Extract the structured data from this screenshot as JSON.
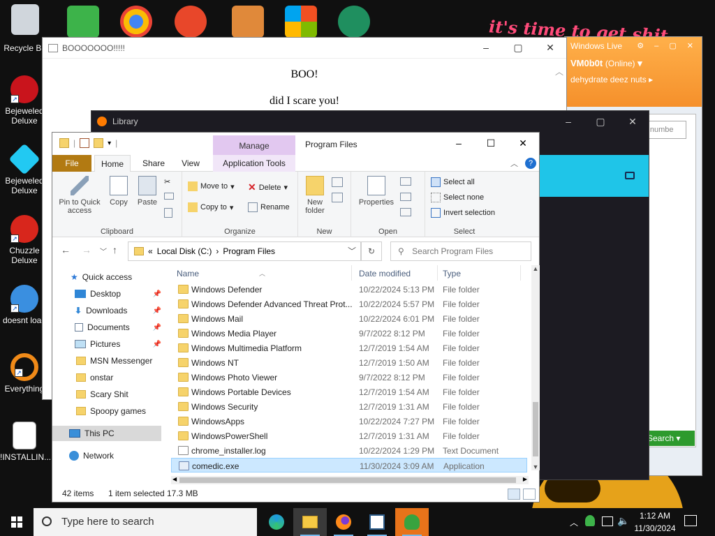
{
  "desktop": {
    "icons": [
      {
        "label": "Recycle Bin"
      },
      {
        "label": "Bejeweled\nDeluxe"
      },
      {
        "label": "Bejeweled\nDeluxe"
      },
      {
        "label": "Chuzzle\nDeluxe"
      },
      {
        "label": "doesnt load"
      },
      {
        "label": "Everything"
      },
      {
        "label": "!INSTALLIN..."
      }
    ],
    "graffiti": "it's time to get shit"
  },
  "boo_window": {
    "title": "BOOOOOOO!!!!!",
    "heading": "BOO!",
    "text": "did I scare you!"
  },
  "messenger": {
    "title": "Windows Live",
    "user": "VM0b0t",
    "status": "(Online)",
    "personal_message": "dehydrate deez nuts",
    "search_placeholder": "or numbe",
    "search_button": "Search"
  },
  "library_window": {
    "title": "Library"
  },
  "explorer": {
    "title": "Program Files",
    "manage_tab": "Manage",
    "tabs": {
      "file": "File",
      "home": "Home",
      "share": "Share",
      "view": "View",
      "app_tools": "Application Tools"
    },
    "ribbon": {
      "pin": "Pin to Quick access",
      "copy": "Copy",
      "paste": "Paste",
      "clipboard": "Clipboard",
      "move_to": "Move to",
      "copy_to": "Copy to",
      "delete": "Delete",
      "rename": "Rename",
      "organize": "Organize",
      "new_folder": "New folder",
      "new": "New",
      "properties": "Properties",
      "open": "Open",
      "select_all": "Select all",
      "select_none": "Select none",
      "invert_selection": "Invert selection",
      "select": "Select"
    },
    "address": {
      "root": "«",
      "disk": "Local Disk (C:)",
      "sep": "›",
      "folder": "Program Files"
    },
    "search_placeholder": "Search Program Files",
    "nav": [
      {
        "label": "Quick access"
      },
      {
        "label": "Desktop",
        "pinned": true
      },
      {
        "label": "Downloads",
        "pinned": true
      },
      {
        "label": "Documents",
        "pinned": true
      },
      {
        "label": "Pictures",
        "pinned": true
      },
      {
        "label": "MSN Messenger"
      },
      {
        "label": "onstar"
      },
      {
        "label": "Scary Shit"
      },
      {
        "label": "Spoopy games"
      },
      {
        "label": "This PC"
      },
      {
        "label": "Network"
      }
    ],
    "columns": {
      "name": "Name",
      "date": "Date modified",
      "type": "Type"
    },
    "files": [
      {
        "name": "Windows Defender",
        "date": "10/22/2024 5:13 PM",
        "type": "File folder",
        "kind": "folder"
      },
      {
        "name": "Windows Defender Advanced Threat Prot...",
        "date": "10/22/2024 5:57 PM",
        "type": "File folder",
        "kind": "folder"
      },
      {
        "name": "Windows Mail",
        "date": "10/22/2024 6:01 PM",
        "type": "File folder",
        "kind": "folder"
      },
      {
        "name": "Windows Media Player",
        "date": "9/7/2022 8:12 PM",
        "type": "File folder",
        "kind": "folder"
      },
      {
        "name": "Windows Multimedia Platform",
        "date": "12/7/2019 1:54 AM",
        "type": "File folder",
        "kind": "folder"
      },
      {
        "name": "Windows NT",
        "date": "12/7/2019 1:50 AM",
        "type": "File folder",
        "kind": "folder"
      },
      {
        "name": "Windows Photo Viewer",
        "date": "9/7/2022 8:12 PM",
        "type": "File folder",
        "kind": "folder"
      },
      {
        "name": "Windows Portable Devices",
        "date": "12/7/2019 1:54 AM",
        "type": "File folder",
        "kind": "folder"
      },
      {
        "name": "Windows Security",
        "date": "12/7/2019 1:31 AM",
        "type": "File folder",
        "kind": "folder"
      },
      {
        "name": "WindowsApps",
        "date": "10/22/2024 7:27 PM",
        "type": "File folder",
        "kind": "folder"
      },
      {
        "name": "WindowsPowerShell",
        "date": "12/7/2019 1:31 AM",
        "type": "File folder",
        "kind": "folder"
      },
      {
        "name": "chrome_installer.log",
        "date": "10/22/2024 1:29 PM",
        "type": "Text Document",
        "kind": "file"
      },
      {
        "name": "comedic.exe",
        "date": "11/30/2024 3:09 AM",
        "type": "Application",
        "kind": "exe",
        "selected": true
      }
    ],
    "status": {
      "items": "42 items",
      "selected": "1 item selected",
      "size": "17.3 MB"
    }
  },
  "taskbar": {
    "search_placeholder": "Type here to search",
    "time": "1:12 AM",
    "date": "11/30/2024"
  },
  "colors": {
    "file_tab": "#b27a12",
    "manage_tab": "#e2c8f0",
    "selection": "#cce8ff",
    "messenger_orange": "#f5902b",
    "library_accent": "#1fc5e8"
  }
}
